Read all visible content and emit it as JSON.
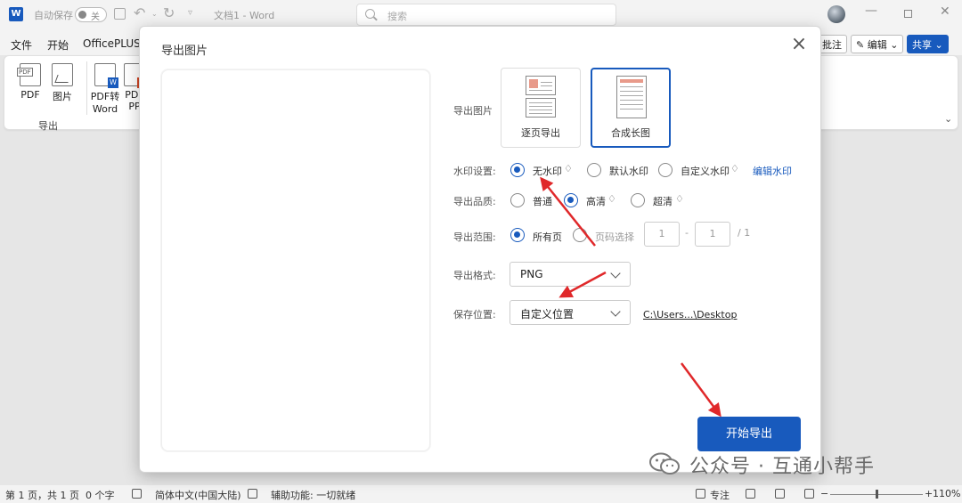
{
  "titlebar": {
    "app_icon_letter": "W",
    "autosave_label": "自动保存",
    "autosave_state": "关",
    "doc_title": "文档1 - Word",
    "search_placeholder": "搜索"
  },
  "ribbon": {
    "tabs": [
      "文件",
      "开始",
      "OfficePLUS"
    ],
    "right_buttons": {
      "comment": "批注",
      "edit": "✎ 编辑 ⌄",
      "share": "共享 ⌄"
    },
    "items": [
      {
        "label": "PDF",
        "tag": "PDF"
      },
      {
        "label": "图片"
      },
      {
        "label": "PDF转",
        "label2": "Word",
        "badge": "W"
      },
      {
        "label": "PDF",
        "label2": "PP",
        "badge": "P"
      }
    ],
    "group_label": "导出"
  },
  "dialog": {
    "title": "导出图片",
    "close": "×",
    "export_image": {
      "label": "导出图片",
      "options": [
        "逐页导出",
        "合成长图"
      ],
      "selected": "合成长图"
    },
    "watermark": {
      "label": "水印设置:",
      "options": [
        "无水印",
        "默认水印",
        "自定义水印"
      ],
      "selected": "无水印",
      "edit_link": "编辑水印"
    },
    "quality": {
      "label": "导出品质:",
      "options": [
        "普通",
        "高清",
        "超清"
      ],
      "selected": "高清"
    },
    "range": {
      "label": "导出范围:",
      "options": [
        "所有页",
        "页码选择"
      ],
      "selected": "所有页",
      "from": "1",
      "dash": "-",
      "to": "1",
      "total": "/ 1"
    },
    "format": {
      "label": "导出格式:",
      "value": "PNG"
    },
    "location": {
      "label": "保存位置:",
      "value": "自定义位置",
      "path": "C:\\Users...\\Desktop"
    },
    "submit": "开始导出"
  },
  "statusbar": {
    "page": "第 1 页，共 1 页",
    "words": "0 个字",
    "language": "简体中文(中国大陆)",
    "accessibility": "辅助功能: 一切就绪",
    "focus": "专注",
    "zoom": "110%"
  },
  "watermark_overlay": {
    "text": "公众号 · 互通小帮手"
  },
  "colors": {
    "accent": "#185abd",
    "arrow": "#e0282a"
  }
}
